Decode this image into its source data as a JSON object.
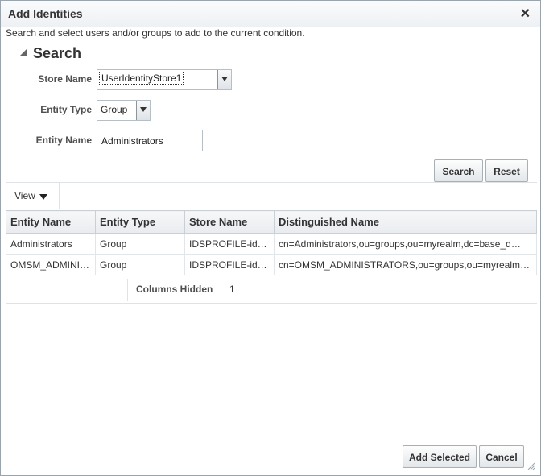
{
  "dialog": {
    "title": "Add Identities",
    "description": "Search and select users and/or groups to add to the current condition.",
    "close_icon": "close-icon"
  },
  "search": {
    "heading": "Search",
    "store_name_label": "Store Name",
    "store_name_value": "UserIdentityStore1",
    "entity_type_label": "Entity Type",
    "entity_type_value": "Group",
    "entity_name_label": "Entity Name",
    "entity_name_value": "Administrators",
    "search_button": "Search",
    "reset_button": "Reset"
  },
  "results": {
    "view_menu": "View",
    "columns": [
      "Entity Name",
      "Entity Type",
      "Store Name",
      "Distinguished Name"
    ],
    "rows": [
      [
        "Administrators",
        "Group",
        "IDSPROFILE-id…",
        "cn=Administrators,ou=groups,ou=myrealm,dc=base_d…"
      ],
      [
        "OMSM_ADMINI…",
        "Group",
        "IDSPROFILE-id…",
        "cn=OMSM_ADMINISTRATORS,ou=groups,ou=myrealm…"
      ]
    ],
    "columns_hidden_label": "Columns Hidden",
    "columns_hidden_count": "1"
  },
  "footer": {
    "add_selected_button": "Add Selected",
    "cancel_button": "Cancel"
  },
  "colors": {
    "title_bar": "#eef1f4",
    "border": "#9aa4ad",
    "text": "#333333"
  }
}
